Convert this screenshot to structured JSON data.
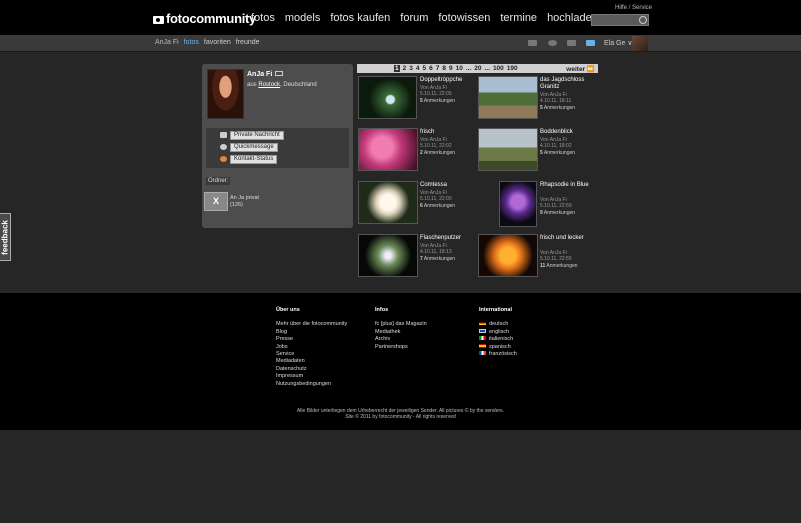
{
  "header": {
    "logo": "fotocommunity",
    "nav": [
      "fotos",
      "models",
      "fotos kaufen",
      "forum",
      "fotowissen",
      "termine",
      "hochladen"
    ],
    "help": "Hilfe / Service",
    "search_placeholder": ""
  },
  "subnav": {
    "user": "AnJa Fi",
    "items": [
      "fotos",
      "favoriten",
      "freunde"
    ],
    "account": "Ela Ge ∨"
  },
  "profile": {
    "name": "AnJa Fi",
    "location_prefix": "aus",
    "city": "Rostock",
    "country": ", Deutschland",
    "actions": [
      "Private Nachricht",
      "Quickmessage",
      "Kontakt-Status"
    ],
    "folder_label": "Ordner:",
    "folder_name": "An Ja privat",
    "folder_count": "(126)",
    "folder_button": "X"
  },
  "pager": {
    "pages": [
      "1",
      "2",
      "3",
      "4",
      "5",
      "6",
      "7",
      "8",
      "9",
      "10",
      "...",
      "20",
      "...",
      "100",
      "190"
    ],
    "current": "1",
    "next": "weiter"
  },
  "photos": [
    {
      "title": "Doppeltröppche",
      "by": "Von AnJa Fi",
      "date": "5.10.11, 22:05",
      "count": "5",
      "suffix": "Anmerkungen"
    },
    {
      "title": "das Jagdschloss Granitz",
      "by": "Von AnJa Fi",
      "date": "4.10.11, 18:11",
      "count": "5",
      "suffix": "Anmerkungen"
    },
    {
      "title": "frisch",
      "by": "Von AnJa Fi",
      "date": "5.10.11, 22:02",
      "count": "2",
      "suffix": "Anmerkungen"
    },
    {
      "title": "Boddenblick",
      "by": "Von AnJa Fi",
      "date": "4.10.11, 18:02",
      "count": "5",
      "suffix": "Anmerkungen"
    },
    {
      "title": "Comtessa",
      "by": "Von AnJa Fi",
      "date": "5.10.11, 22:00",
      "count": "6",
      "suffix": "Anmerkungen"
    },
    {
      "title": "Rhapsodie in Blue",
      "by": "Von AnJa Fi",
      "date": "5.10.11, 22:59",
      "count": "9",
      "suffix": "Anmerkungen"
    },
    {
      "title": "Flaschenputzer",
      "by": "Von AnJa Fi",
      "date": "4.10.11, 18:13",
      "count": "7",
      "suffix": "Anmerkungen"
    },
    {
      "title": "frisch und lecker",
      "by": "Von AnJa Fi",
      "date": "5.10.11, 22:55",
      "count": "11",
      "suffix": "Anmerkungen"
    }
  ],
  "footer": {
    "ueber": {
      "heading": "Über uns",
      "links": [
        "Mehr über die fotocommunity",
        "Blog",
        "Presse",
        "Jobs",
        "Service",
        "Mediadaten",
        "Datenschutz",
        "Impressum",
        "Nutzungsbedingungen"
      ]
    },
    "infos": {
      "heading": "Infos",
      "links": [
        "fc [plus] das Magazin",
        "Mediathek",
        "Archiv",
        "Partnershops"
      ]
    },
    "intl": {
      "heading": "International",
      "links": [
        "deutsch",
        "englisch",
        "italienisch",
        "spanisch",
        "französisch"
      ]
    },
    "copyright1": "Alle Bilder unterliegen dem Urheberrecht der jeweiligen Sender. All pictures © by the senders.",
    "copyright2": "Site © 2011 by fotocommunity - All rights reserved"
  },
  "feedback": "feedback",
  "colors": {
    "accent": "#68b2e8",
    "header_bg": "#000000",
    "panel_bg": "#4d4d4d"
  }
}
